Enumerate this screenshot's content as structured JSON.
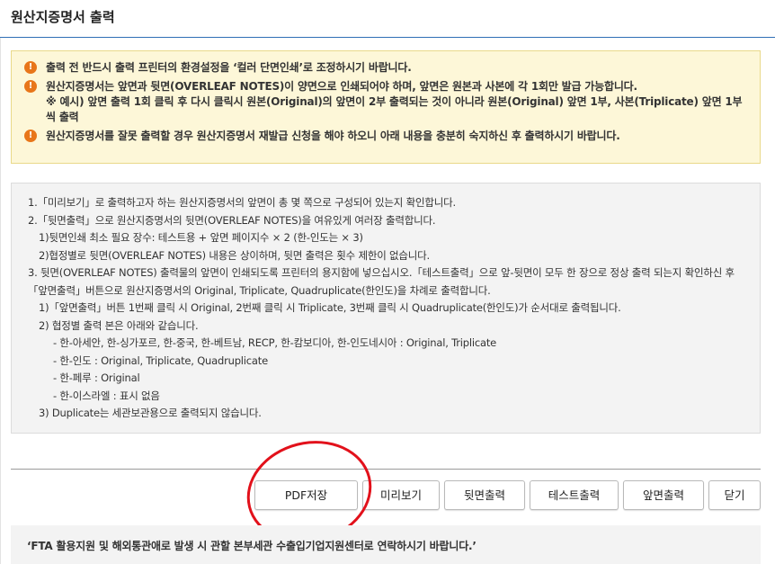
{
  "window": {
    "title": "원산지증명서 출력"
  },
  "notice": {
    "items": [
      "출력 전 반드시 출력 프린터의 환경설정을 ‘컬러 단면인쇄’로 조정하시기 바랍니다.",
      "원산지증명서는 앞면과 뒷면(OVERLEAF NOTES)이 양면으로 인쇄되어야 하며, 앞면은 원본과 사본에 각 1회만 발급 가능합니다.",
      "원산지증명서를 잘못 출력할 경우 원산지증명서 재발급 신청을 해야 하오니 아래 내용을 충분히 숙지하신 후 출력하시기 바랍니다."
    ],
    "example": "※ 예시) 앞면 출력 1회 클릭 후 다시 클릭시 원본(Original)의 앞면이 2부 출력되는 것이 아니라 원본(Original) 앞면 1부, 사본(Triplicate) 앞면 1부씩 출력"
  },
  "guide": {
    "lines": [
      "1.「미리보기」로 출력하고자 하는 원산지증명서의 앞면이 총 몇 쪽으로 구성되어 있는지 확인합니다.",
      "2.「뒷면출력」으로 원산지증명서의 뒷면(OVERLEAF NOTES)을 여유있게 여러장 출력합니다.",
      "1)뒷면인쇄 최소 필요 장수: 테스트용 + 앞면 페이지수 × 2 (한-인도는 × 3)",
      "2)협정별로 뒷면(OVERLEAF NOTES) 내용은 상이하며, 뒷면 출력은 횟수 제한이 없습니다.",
      "3. 뒷면(OVERLEAF NOTES) 출력물의 앞면이 인쇄되도록 프린터의 용지함에 넣으십시오.「테스트출력」으로 앞-뒷면이 모두 한 장으로 정상 출력 되는지 확인하신 후「앞면출력」버튼으로 원산지증명서의 Original, Triplicate, Quadruplicate(한인도)을 차례로 출력합니다.",
      "1)「앞면출력」버튼 1번째 클릭 시 Original, 2번째 클릭 시 Triplicate, 3번째 클릭 시 Quadruplicate(한인도)가 순서대로 출력됩니다.",
      "2) 협정별 출력 본은 아래와 같습니다.",
      "- 한-아세안, 한-싱가포르, 한-중국, 한-베트남, RECP, 한-캄보디아, 한-인도네시아 : Original, Triplicate",
      "- 한-인도 : Original, Triplicate, Quadruplicate",
      "- 한-페루 : Original",
      "- 한-이스라엘 : 표시 없음",
      "3) Duplicate는 세관보관용으로 출력되지 않습니다."
    ]
  },
  "buttons": {
    "pdf_save": "PDF저장",
    "preview": "미리보기",
    "back_print": "뒷면출력",
    "test_print": "테스트출력",
    "front_print": "앞면출력",
    "close": "닫기"
  },
  "footer": {
    "text": "‘FTA 활용지원 및 해외통관애로 발생 시 관할 본부세관 수출입기업지원센터로 연락하시기 바랍니다.’"
  },
  "colors": {
    "title_rule": "#2f6fb5",
    "notice_bg": "#fdf7d8",
    "notice_border": "#e9d98a",
    "warning_icon": "#e8761a",
    "guide_bg": "#f3f3f3",
    "annotation": "#e2111b"
  },
  "icons": {
    "notice_item": "exclamation-circle-icon"
  }
}
